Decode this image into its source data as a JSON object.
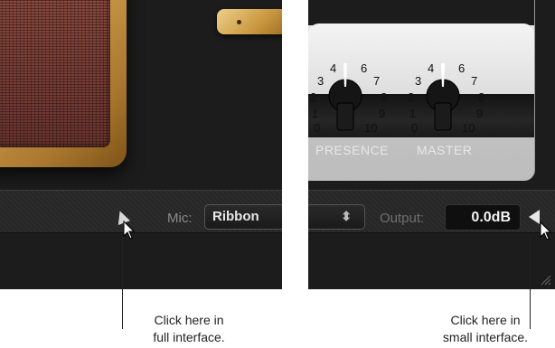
{
  "left_panel": {
    "mic_label": "Mic:",
    "mic_value": "Ribbon"
  },
  "right_panel": {
    "knobs": [
      {
        "name": "PRESENCE",
        "scale": [
          "0",
          "1",
          "2",
          "3",
          "4",
          "6",
          "7",
          "8",
          "9",
          "10"
        ]
      },
      {
        "name": "MASTER",
        "scale": [
          "0",
          "1",
          "2",
          "3",
          "4",
          "6",
          "7",
          "8",
          "9",
          "10"
        ]
      }
    ],
    "output_label": "Output:",
    "output_value": "0.0dB"
  },
  "callouts": {
    "full": [
      "Click here in",
      "full interface."
    ],
    "small": [
      "Click here in",
      "small interface."
    ]
  },
  "icons": {
    "expand": "triangle-right-icon",
    "collapse": "triangle-left-icon",
    "dropdown": "up-down-chevron-icon",
    "cursor": "mouse-pointer-icon",
    "grip": "resize-grip-icon"
  }
}
